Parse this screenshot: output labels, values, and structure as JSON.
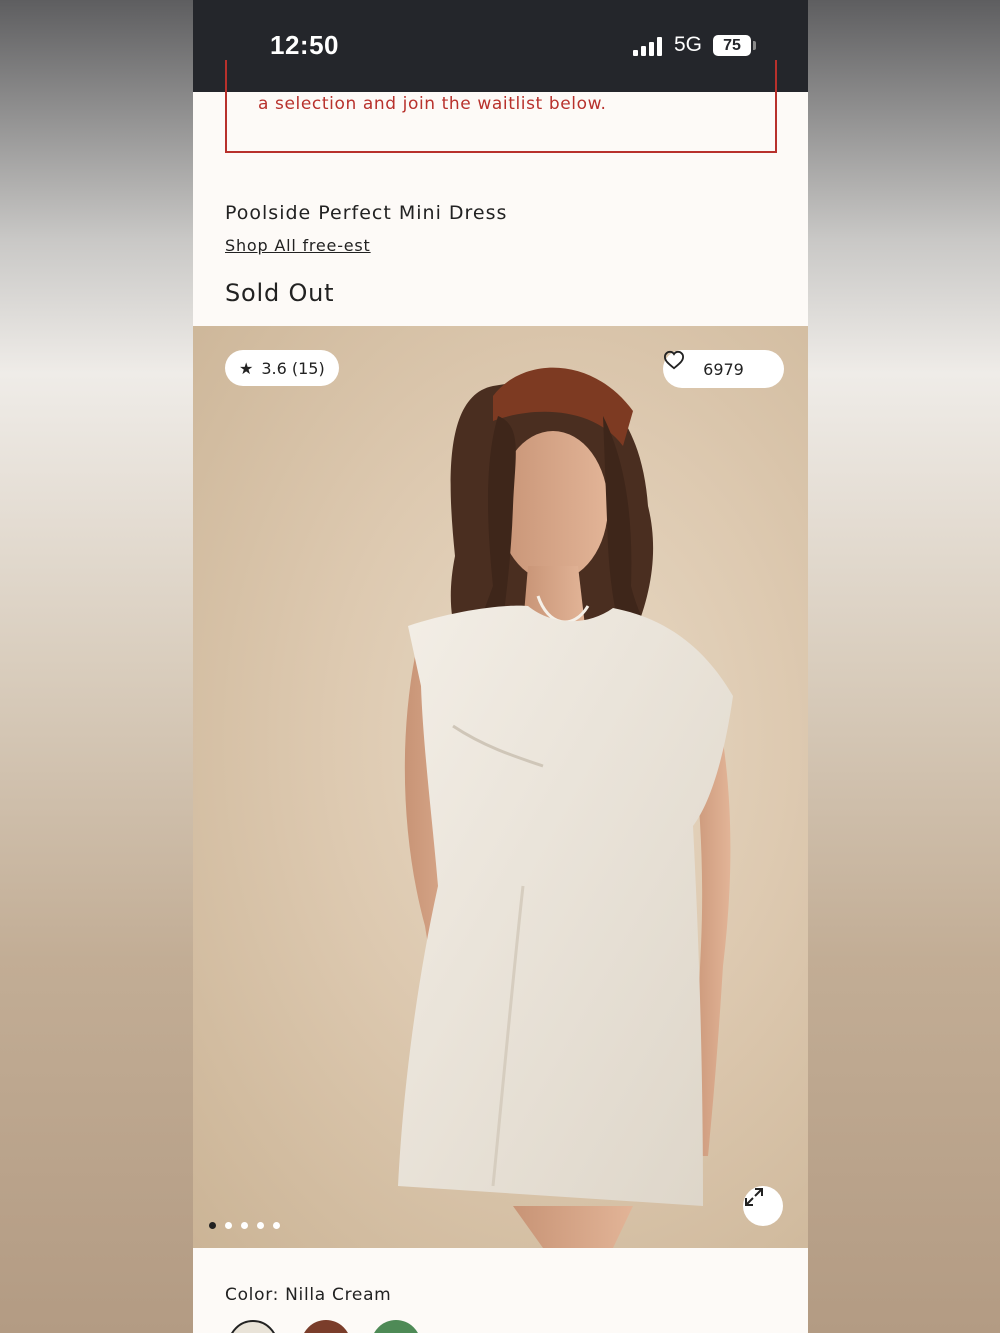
{
  "status_bar": {
    "time": "12:50",
    "network": "5G",
    "battery": "75"
  },
  "notice": {
    "text": "a selection and join the waitlist below."
  },
  "product": {
    "title": "Poolside Perfect Mini Dress",
    "shop_link": "Shop All free-est",
    "availability": "Sold Out"
  },
  "gallery": {
    "rating": "3.6 (15)",
    "favorites": "6979",
    "image_count": 5,
    "active_index": 0
  },
  "color": {
    "label": "Color: Nilla Cream",
    "swatches": [
      {
        "name": "Nilla Cream",
        "color": "#e9e3d8",
        "selected": true
      },
      {
        "name": "brown",
        "color": "#7a3d2a",
        "selected": false
      },
      {
        "name": "green",
        "color": "#4e8a56",
        "selected": false
      }
    ]
  },
  "colors": {
    "status_bar": "#24262b",
    "alert": "#b8312c",
    "page_bg": "#fdfaf7"
  }
}
